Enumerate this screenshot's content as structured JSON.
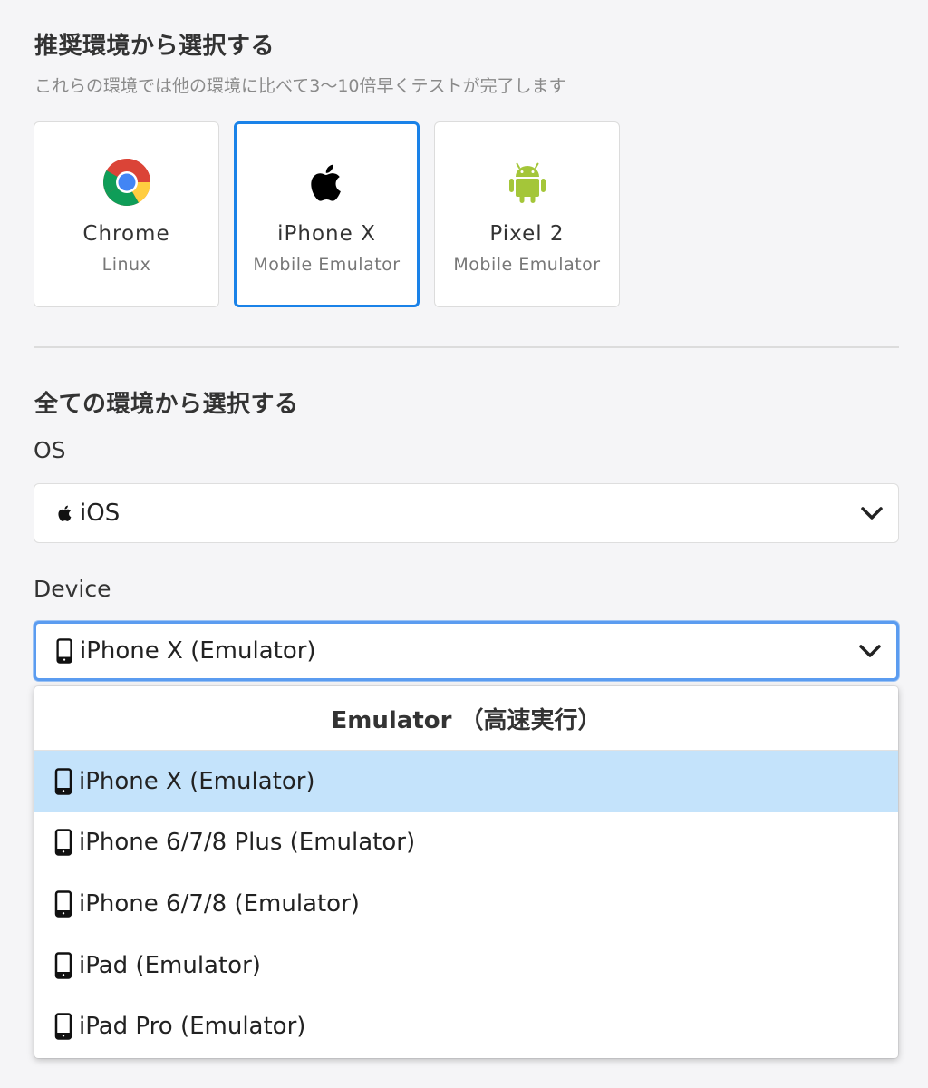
{
  "recommended": {
    "title": "推奨環境から選択する",
    "subtitle": "これらの環境では他の環境に比べて3〜10倍早くテストが完了します",
    "cards": [
      {
        "name": "Chrome",
        "kind": "Linux",
        "icon": "chrome-icon",
        "selected": false
      },
      {
        "name": "iPhone X",
        "kind": "Mobile Emulator",
        "icon": "apple-icon",
        "selected": true
      },
      {
        "name": "Pixel 2",
        "kind": "Mobile Emulator",
        "icon": "android-icon",
        "selected": false
      }
    ]
  },
  "all": {
    "title": "全ての環境から選択する",
    "os_label": "OS",
    "os_value": "iOS",
    "device_label": "Device",
    "device_value": "iPhone X (Emulator)"
  },
  "dropdown": {
    "group_header": "Emulator （高速実行）",
    "options": [
      {
        "label": "iPhone X (Emulator)",
        "highlighted": true
      },
      {
        "label": "iPhone 6/7/8 Plus (Emulator)",
        "highlighted": false
      },
      {
        "label": "iPhone 6/7/8 (Emulator)",
        "highlighted": false
      },
      {
        "label": "iPad (Emulator)",
        "highlighted": false
      },
      {
        "label": "iPad Pro (Emulator)",
        "highlighted": false
      }
    ]
  },
  "colors": {
    "accent": "#1a82e8",
    "focus": "#5b9cf0",
    "highlight": "#c4e3fb",
    "android": "#a4c639"
  }
}
